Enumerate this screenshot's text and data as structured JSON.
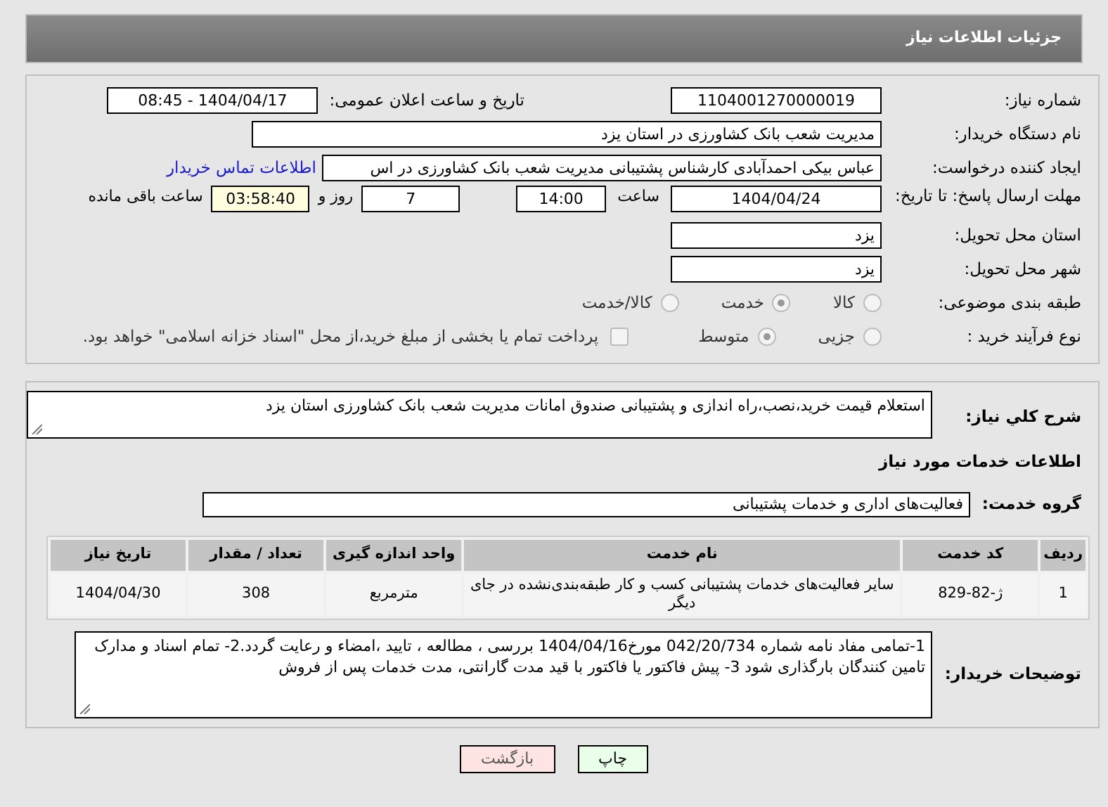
{
  "title": "جزئیات اطلاعات نیاز",
  "need_number": {
    "label": "شماره نیاز:",
    "value": "1104001270000019"
  },
  "announce": {
    "label": "تاریخ و ساعت اعلان عمومی:",
    "value": "1404/04/17 - 08:45"
  },
  "buyer": {
    "label": "نام دستگاه خریدار:",
    "value": "مدیریت شعب بانک کشاورزی در استان یزد"
  },
  "requester": {
    "label": "ایجاد کننده درخواست:",
    "value": "عباس بیکی احمدآبادی کارشناس پشتیبانی مدیریت شعب بانک کشاورزی در اس",
    "link": "اطلاعات تماس خریدار"
  },
  "deadline": {
    "label": "مهلت ارسال پاسخ: تا تاریخ:",
    "date": "1404/04/24",
    "time_label": "ساعت",
    "time": "14:00",
    "days": "7",
    "days_label": "روز و",
    "remaining": "03:58:40",
    "remaining_label": "ساعت باقی مانده"
  },
  "province": {
    "label": "استان محل تحویل:",
    "value": "یزد"
  },
  "city": {
    "label": "شهر محل تحویل:",
    "value": "یزد"
  },
  "category": {
    "label": "طبقه بندی موضوعی:",
    "options": [
      {
        "label": "کالا",
        "selected": false
      },
      {
        "label": "خدمت",
        "selected": true
      },
      {
        "label": "کالا/خدمت",
        "selected": false
      }
    ]
  },
  "process": {
    "label": "نوع فرآیند خرید :",
    "options": [
      {
        "label": "جزیی",
        "selected": false
      },
      {
        "label": "متوسط",
        "selected": true
      }
    ],
    "payment": {
      "label": "پرداخت تمام یا بخشی از مبلغ خرید،از محل \"اسناد خزانه اسلامی\" خواهد بود.",
      "checked": false
    }
  },
  "description": {
    "label": "شرح كلي نياز:",
    "value": "استعلام قیمت خرید،نصب،راه اندازی و پشتیبانی صندوق امانات مدیریت شعب بانک کشاورزی استان یزد"
  },
  "services_heading": "اطلاعات خدمات مورد نیاز",
  "service_group": {
    "label": "گروه خدمت:",
    "value": "فعالیت‌های اداری و خدمات پشتیبانی"
  },
  "table": {
    "columns": [
      "ردیف",
      "کد خدمت",
      "نام خدمت",
      "واحد اندازه گیری",
      "تعداد / مقدار",
      "تاریخ نیاز"
    ],
    "rows": [
      [
        "1",
        "ژ-82-829",
        "سایر فعالیت‌های خدمات پشتیبانی کسب و کار طبقه‌بندی‌نشده در جای دیگر",
        "مترمربع",
        "308",
        "1404/04/30"
      ]
    ]
  },
  "buyer_notes": {
    "label": "توضیحات خریدار:",
    "value": "1-تمامی مفاد نامه شماره 042/20/734 مورخ1404/04/16 بررسی ، مطالعه ، تایید ،امضاء و رعایت گردد.2- تمام اسناد و مدارک تامین کنندگان بارگذاری شود 3- پیش فاکتور یا فاکتور با قید مدت گارانتی، مدت خدمات پس از فروش"
  },
  "buttons": [
    {
      "label": "چاپ",
      "kind": "print"
    },
    {
      "label": "بازگشت",
      "kind": "back"
    }
  ]
}
